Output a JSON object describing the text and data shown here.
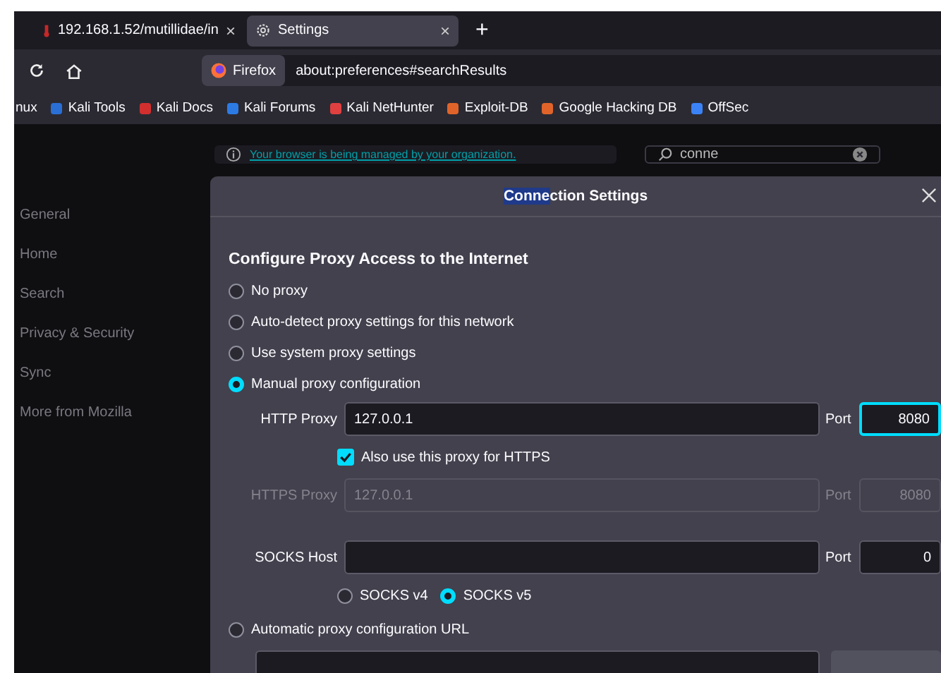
{
  "tabs": [
    {
      "label": "192.168.1.52/mutillidae/in",
      "selected": false,
      "close": "×"
    },
    {
      "label": "Settings",
      "selected": true,
      "close": "×"
    }
  ],
  "new_tab": "+",
  "address_bar": {
    "badge": "Firefox",
    "url": "about:preferences#searchResults"
  },
  "bookmarks": [
    "nux",
    "Kali Tools",
    "Kali Docs",
    "Kali Forums",
    "Kali NetHunter",
    "Exploit-DB",
    "Google Hacking DB",
    "OffSec"
  ],
  "notice": {
    "link": "Your browser is being managed by your organization."
  },
  "search": {
    "value": "conne"
  },
  "sidebar": {
    "items": [
      {
        "label": "General",
        "selected": false
      },
      {
        "label": "Home",
        "selected": false
      },
      {
        "label": "Search",
        "selected": false
      },
      {
        "label": "Privacy & Security",
        "selected": false
      },
      {
        "label": "Sync",
        "selected": false
      },
      {
        "label": "More from Mozilla",
        "selected": false
      }
    ]
  },
  "dialog": {
    "title": {
      "highlight": "Conne",
      "rest": "ction Settings"
    },
    "heading": "Configure Proxy Access to the Internet",
    "proxy_modes": [
      {
        "label": "No proxy",
        "selected": false
      },
      {
        "label": "Auto-detect proxy settings for this network",
        "selected": false
      },
      {
        "label": "Use system proxy settings",
        "selected": false
      },
      {
        "label": "Manual proxy configuration",
        "selected": true
      }
    ],
    "http": {
      "label": "HTTP Proxy",
      "value": "127.0.0.1",
      "port_label": "Port",
      "port": "8080",
      "port_focused": true,
      "disabled": false
    },
    "also_https": {
      "label": "Also use this proxy for HTTPS",
      "checked": true
    },
    "https": {
      "label": "HTTPS Proxy",
      "value": "127.0.0.1",
      "port_label": "Port",
      "port": "8080",
      "port_focused": false,
      "disabled": true
    },
    "socks": {
      "label": "SOCKS Host",
      "port_label": "Port",
      "port": "0",
      "port_focused": false,
      "disabled": false
    },
    "socks_versions": [
      {
        "label": "SOCKS v4",
        "selected": false
      },
      {
        "label": "SOCKS v5",
        "selected": true
      }
    ],
    "auto_config": {
      "label": "Automatic proxy configuration URL",
      "selected": false
    }
  }
}
